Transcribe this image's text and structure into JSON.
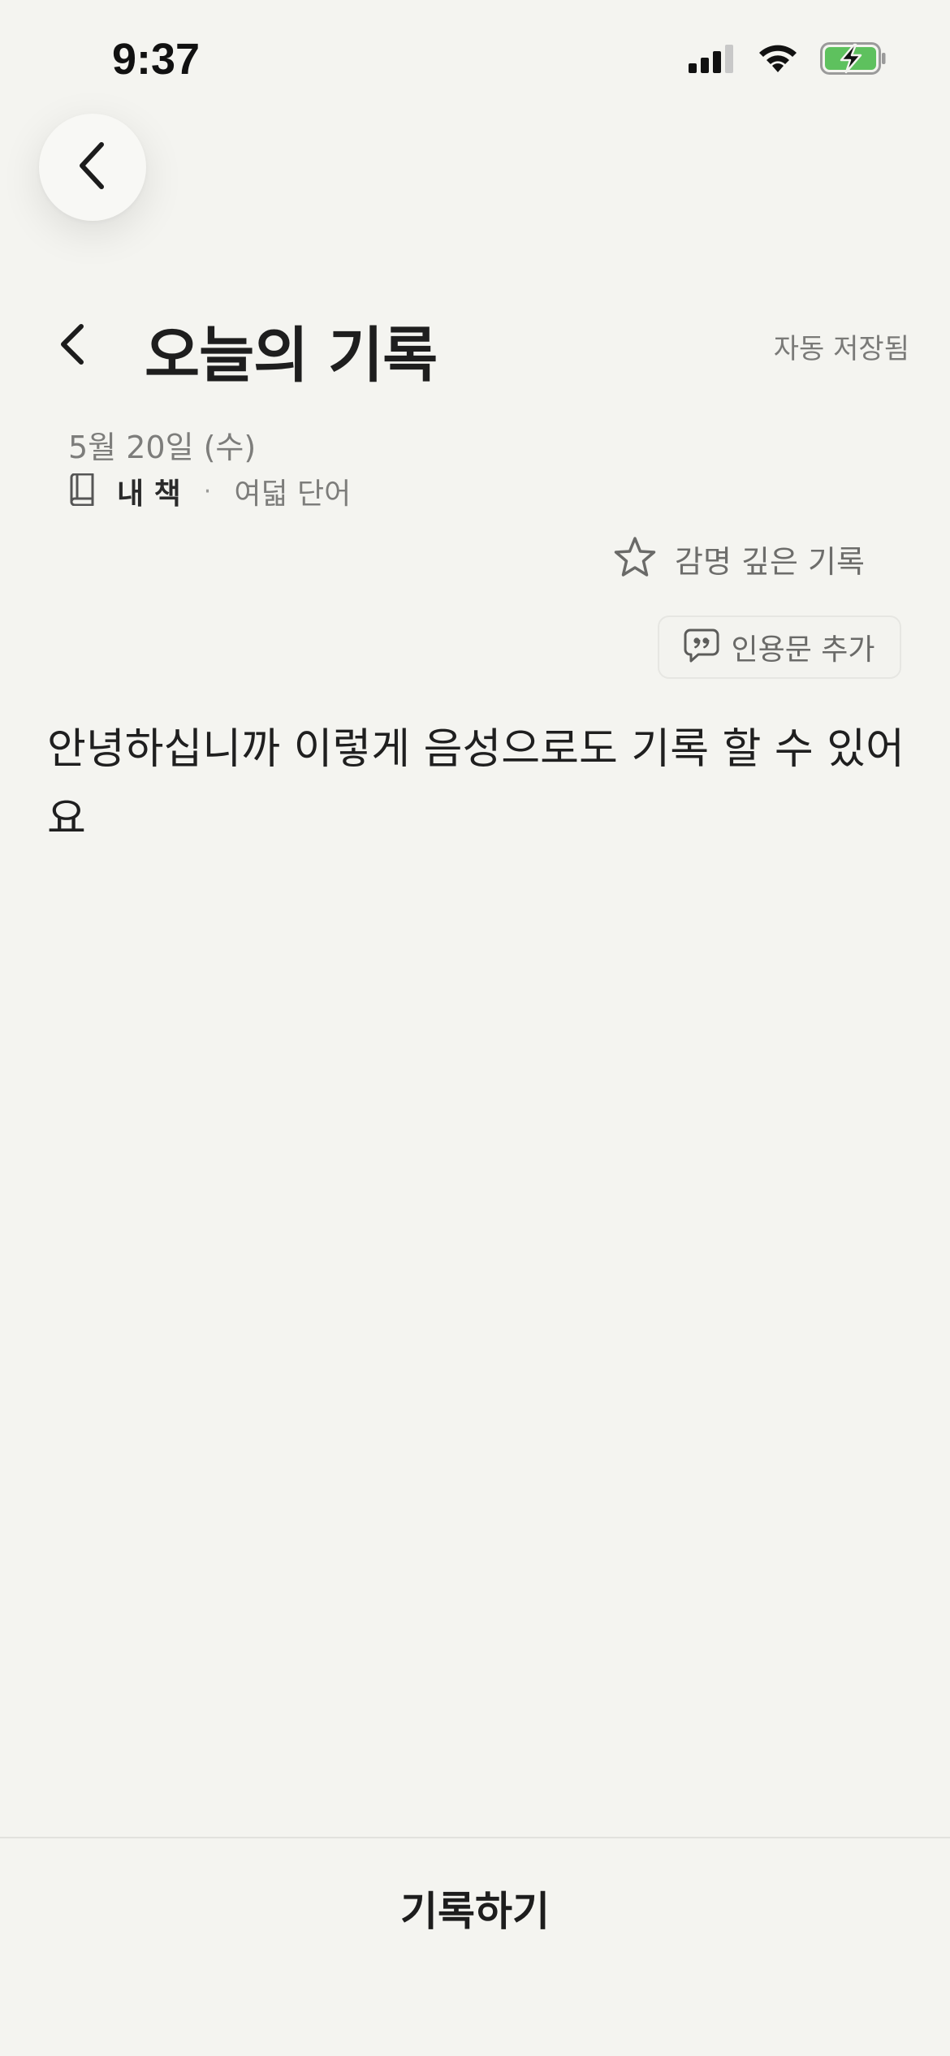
{
  "status_bar": {
    "time": "9:37",
    "icons": [
      "signal-icon",
      "wifi-icon",
      "battery-charging-icon"
    ]
  },
  "header": {
    "title": "오늘의 기록",
    "autosave_status": "자동 저장됨"
  },
  "entry": {
    "date": "5월 20일 (수)",
    "book": "내 책",
    "separator": "·",
    "word_count": "여덟 단어",
    "favorite_label": "감명 깊은 기록",
    "add_quote_label": "인용문 추가",
    "content": "안녕하십니까 이렇게 음성으로도 기록 할 수 있어요"
  },
  "footer": {
    "record_label": "기록하기"
  },
  "colors": {
    "background": "#f4f4f0",
    "battery_fill": "#5ec15e",
    "text_primary": "#1e1e1e",
    "text_secondary": "#7a7a78"
  }
}
